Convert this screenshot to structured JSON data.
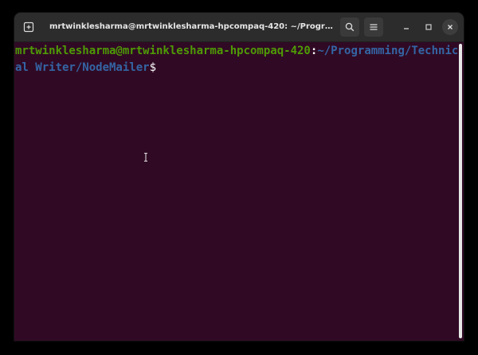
{
  "window": {
    "title": "mrtwinklesharma@mrtwinklesharma-hpcompaq-420: ~/Programm..."
  },
  "terminal": {
    "prompt_user": "mrtwinklesharma@mrtwinklesharma-hpcompaq-420",
    "prompt_colon": ":",
    "prompt_path": "~/Programming/Technical Writer/NodeMailer",
    "prompt_symbol": "$"
  },
  "icons": {
    "new_tab": "new-tab-icon",
    "search": "search-icon",
    "menu": "hamburger-menu-icon",
    "minimize": "minimize-icon",
    "maximize": "maximize-icon",
    "close": "close-icon",
    "cursor": "text-cursor-icon"
  },
  "colors": {
    "terminal_bg": "#300a24",
    "user_green": "#4e9a06",
    "path_blue": "#3465a4",
    "titlebar_bg": "#2c2c2c"
  }
}
